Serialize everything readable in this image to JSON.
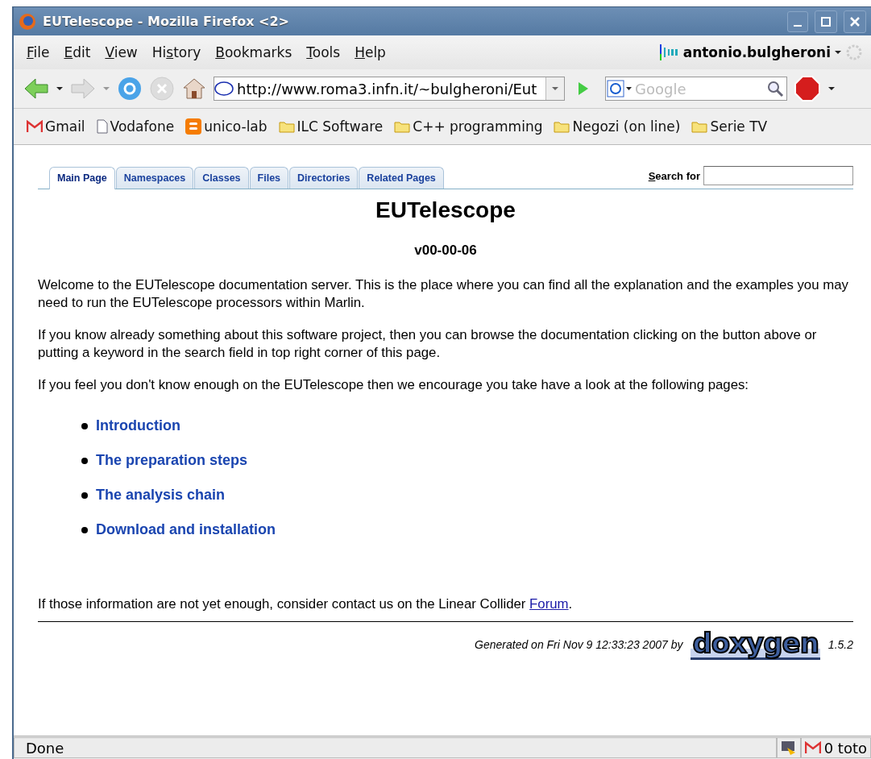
{
  "window": {
    "title": "EUTelescope - Mozilla Firefox <2>"
  },
  "menu": [
    {
      "key": "F",
      "after": "ile"
    },
    {
      "key": "E",
      "after": "dit"
    },
    {
      "key": "V",
      "after": "iew"
    },
    {
      "before": "Hi",
      "key": "s",
      "after": "tory"
    },
    {
      "key": "B",
      "after": "ookmarks"
    },
    {
      "key": "T",
      "after": "ools"
    },
    {
      "key": "H",
      "after": "elp"
    }
  ],
  "account": {
    "name": "antonio.bulgheroni"
  },
  "address": {
    "value": "http://www.roma3.infn.it/~bulgheroni/Eut"
  },
  "search": {
    "placeholder": "Google"
  },
  "bookmarks": [
    {
      "label": "Gmail",
      "kind": "gmail"
    },
    {
      "label": "Vodafone",
      "kind": "page"
    },
    {
      "label": "unico-lab",
      "kind": "blogger"
    },
    {
      "label": "ILC Software",
      "kind": "folder"
    },
    {
      "label": "C++ programming",
      "kind": "folder"
    },
    {
      "label": "Negozi (on line)",
      "kind": "folder"
    },
    {
      "label": "Serie TV",
      "kind": "folder"
    }
  ],
  "page": {
    "tabs": [
      {
        "label": "Main Page",
        "selected": true
      },
      {
        "label": "Namespaces",
        "selected": false
      },
      {
        "label": "Classes",
        "selected": false
      },
      {
        "label": "Files",
        "selected": false
      },
      {
        "label": "Directories",
        "selected": false
      },
      {
        "label": "Related Pages",
        "selected": false
      }
    ],
    "search_label": {
      "key": "S",
      "after": "earch for"
    },
    "title": "EUTelescope",
    "version": "v00-00-06",
    "paragraphs": [
      "Welcome to the EUTelescope documentation server. This is the place where you can find all the explanation and the examples you may need to run the EUTelescope processors within Marlin.",
      "If you know already something about this software project, then you can browse the documentation clicking on the button above or putting a keyword in the search field in top right corner of this page.",
      "If you feel you don't know enough on the EUTelescope then we encourage you take have a look at the following pages:"
    ],
    "links": [
      "Introduction",
      "The preparation steps",
      "The analysis chain",
      "Download and installation"
    ],
    "closing": {
      "before": "If those information are not yet enough, consider contact us on the Linear Collider ",
      "link": "Forum",
      "after": "."
    },
    "footer": {
      "generated": "Generated on Fri Nov 9 12:33:23 2007 by",
      "logo": "doxygen",
      "version": "1.5.2"
    }
  },
  "status_bar": {
    "text": "Done",
    "mail": "0 toto"
  }
}
